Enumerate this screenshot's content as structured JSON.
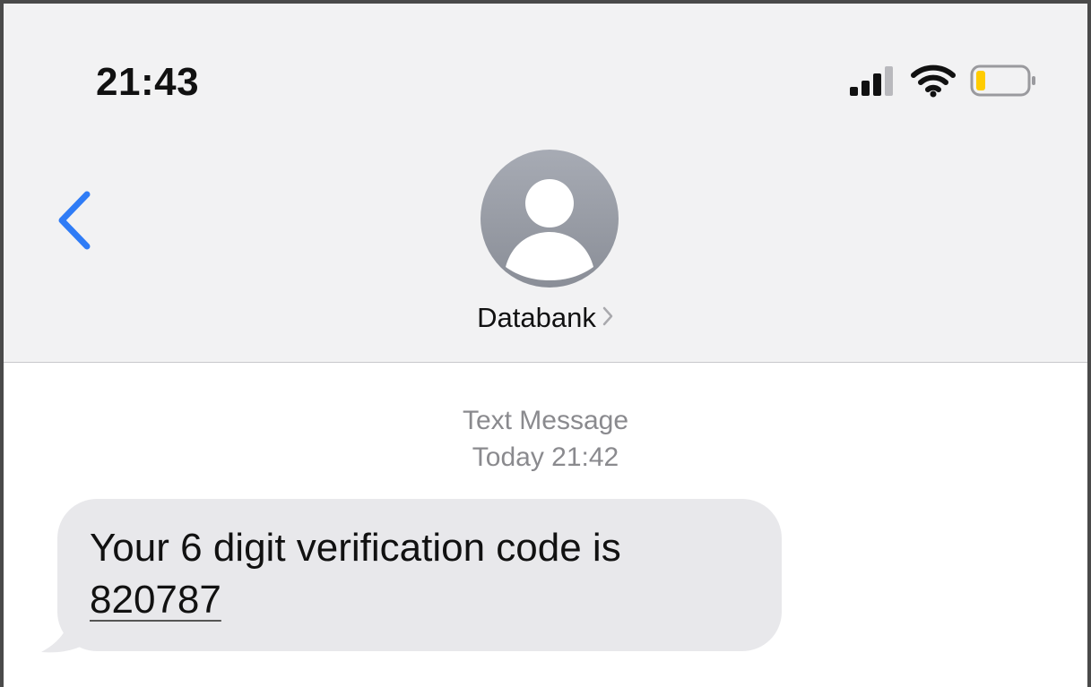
{
  "status_bar": {
    "time": "21:43",
    "icons": [
      "signal-icon",
      "wifi-icon",
      "battery-icon"
    ],
    "battery_color": "#ffcc00"
  },
  "nav": {
    "back_icon": "chevron-left-icon",
    "contact_name": "Databank",
    "accent_color": "#2f7cf6"
  },
  "conversation": {
    "service_label": "Text Message",
    "timestamp": "Today 21:42",
    "messages": [
      {
        "direction": "incoming",
        "text": "Your 6 digit verification code is",
        "link_text": "820787"
      }
    ]
  }
}
